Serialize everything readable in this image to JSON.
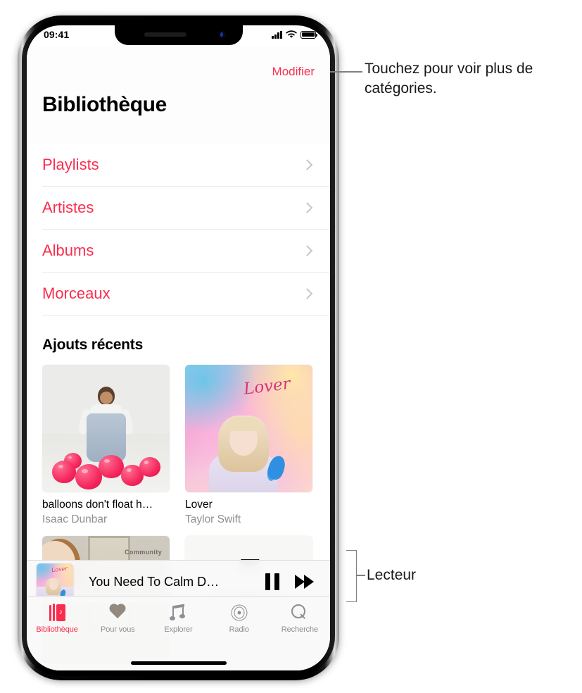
{
  "status_bar": {
    "time": "09:41",
    "cellular_icon": "cellular-signal-icon",
    "wifi_icon": "wifi-icon",
    "battery_icon": "battery-icon"
  },
  "nav": {
    "edit_label": "Modifier",
    "title": "Bibliothèque"
  },
  "categories": [
    {
      "label": "Playlists",
      "chevron": "chevron-right-icon"
    },
    {
      "label": "Artistes",
      "chevron": "chevron-right-icon"
    },
    {
      "label": "Albums",
      "chevron": "chevron-right-icon"
    },
    {
      "label": "Morceaux",
      "chevron": "chevron-right-icon"
    }
  ],
  "recent": {
    "heading": "Ajouts récents",
    "albums": [
      {
        "title": "balloons don't float h…",
        "artist": "Isaac Dunbar"
      },
      {
        "title": "Lover",
        "artist": "Taylor Swift"
      }
    ],
    "partial_album_word": "Community"
  },
  "player": {
    "now_playing": "You Need To Calm D…",
    "artwork_label": "Lover",
    "pause_icon": "pause-icon",
    "forward_icon": "fast-forward-icon"
  },
  "tabs": [
    {
      "label": "Bibliothèque",
      "icon": "library-icon",
      "active": true
    },
    {
      "label": "Pour vous",
      "icon": "heart-icon",
      "active": false
    },
    {
      "label": "Explorer",
      "icon": "music-note-icon",
      "active": false
    },
    {
      "label": "Radio",
      "icon": "radio-waves-icon",
      "active": false
    },
    {
      "label": "Recherche",
      "icon": "search-icon",
      "active": false
    }
  ],
  "callouts": {
    "edit": "Touchez pour voir plus de catégories.",
    "player": "Lecteur"
  },
  "colors": {
    "accent_pink": "#FA2D4E",
    "secondary_text": "#8E8E93",
    "separator": "#E9E9E9",
    "callout_text": "#1A1A1A",
    "leader_line": "#7F7F7F"
  }
}
